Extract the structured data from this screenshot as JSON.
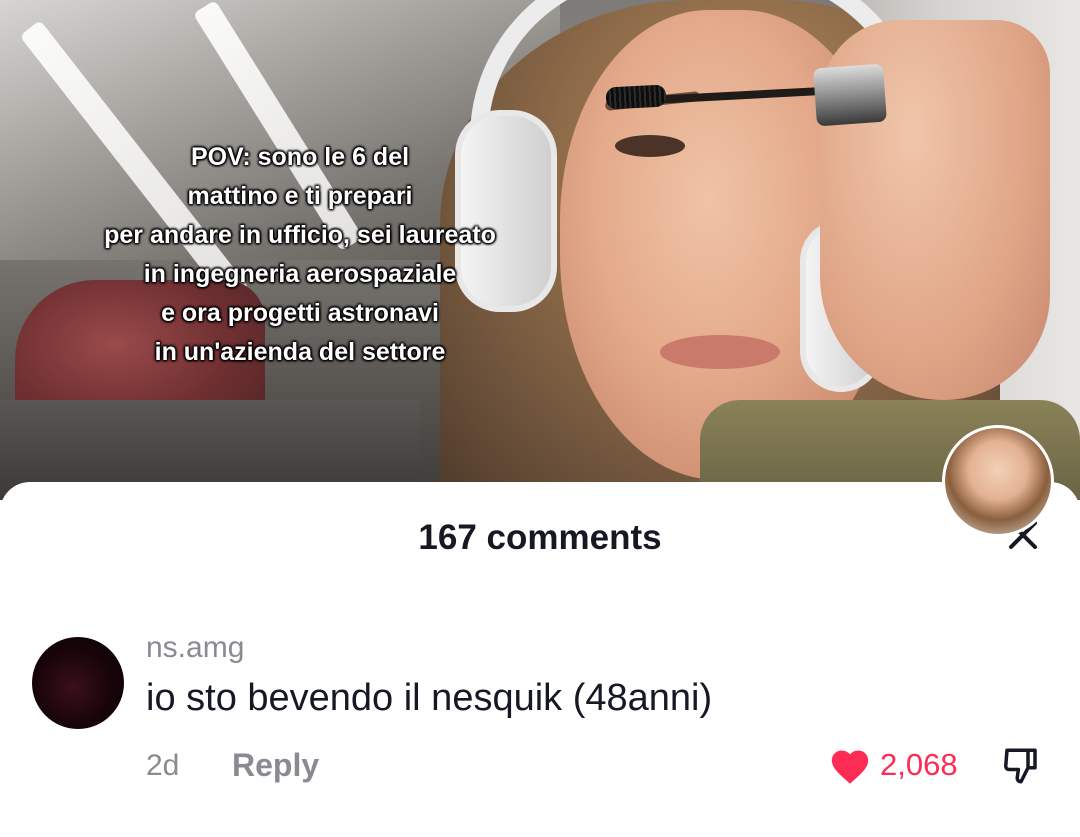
{
  "video": {
    "caption_lines": [
      "POV: sono le 6 del",
      "mattino e ti prepari",
      "per andare in ufficio, sei laureato",
      "in ingegneria aerospaziale",
      "e ora progetti astronavi",
      "in un'azienda del settore"
    ]
  },
  "comments_sheet": {
    "title": "167 comments",
    "close_icon": "close-icon",
    "comments": [
      {
        "username": "ns.amg",
        "text": "io sto bevendo il nesquik (48anni)",
        "time": "2d",
        "reply_label": "Reply",
        "like_count": "2,068",
        "like_icon": "heart-icon",
        "dislike_icon": "thumbs-down-icon"
      }
    ]
  },
  "colors": {
    "like_red": "#fe2c55",
    "text_primary": "#161823",
    "text_secondary": "#8a8b91"
  }
}
